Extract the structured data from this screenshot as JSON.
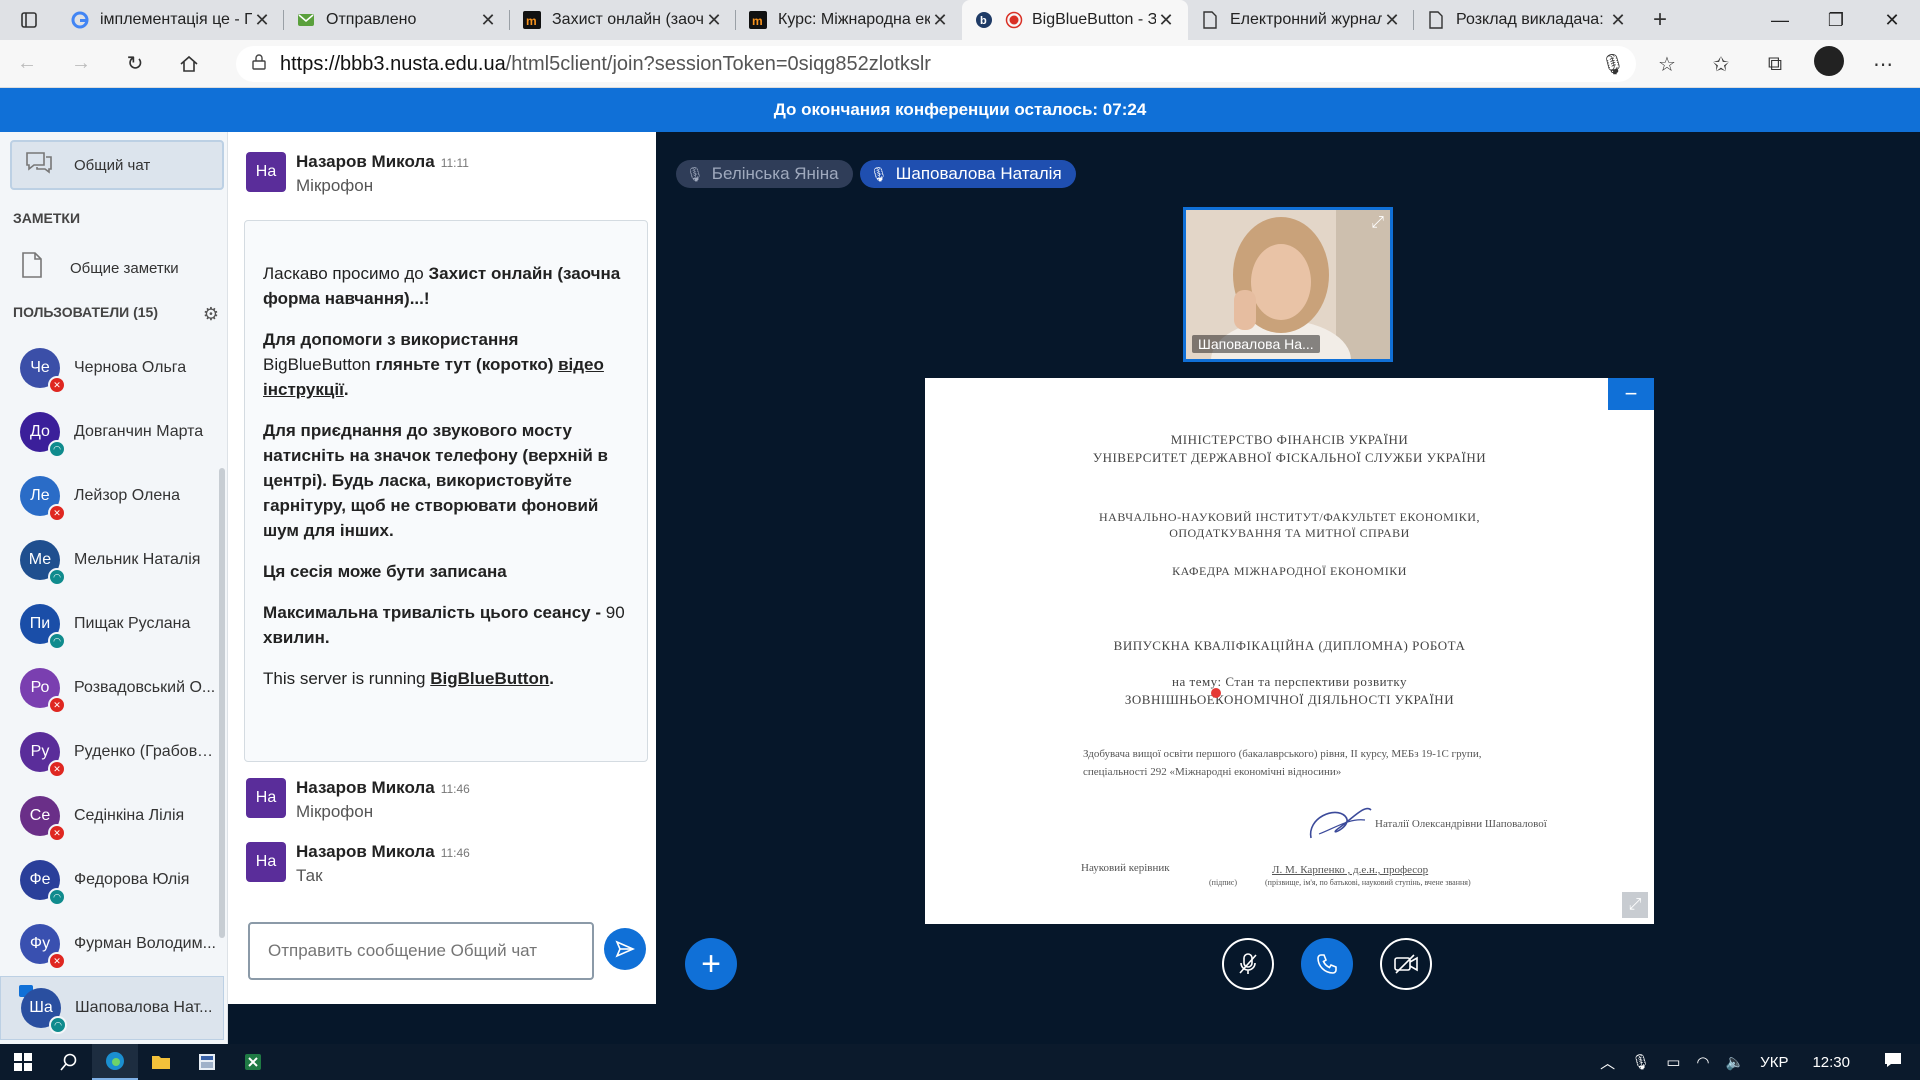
{
  "browser": {
    "tabs": [
      {
        "title": "імплементація це - Пошук",
        "icon": "google-icon"
      },
      {
        "title": "Отправлено",
        "icon": "mail-icon"
      },
      {
        "title": "Захист онлайн (заочна форма)",
        "icon": "moodle-icon"
      },
      {
        "title": "Курс: Міжнародна економіка",
        "icon": "moodle-icon"
      },
      {
        "title": "BigBlueButton - Захист",
        "icon": "bbb-icon",
        "active": true
      },
      {
        "title": "Електронний журнал",
        "icon": "page-icon"
      },
      {
        "title": "Розклад викладача: Карпенко",
        "icon": "page-icon"
      }
    ],
    "url_host": "https://bbb3.nusta.edu.ua",
    "url_path": "/html5client/join?sessionToken=0siqg852zlotkslr"
  },
  "banner": {
    "text": "До окончания конференции осталось: 07:24"
  },
  "sidebar": {
    "public_chat": "Общий чат",
    "notes_title": "ЗАМЕТКИ",
    "shared_notes": "Общие заметки",
    "users_title": "ПОЛЬЗОВАТЕЛИ (15)",
    "users": [
      {
        "initials": "Че",
        "name": "Чернова Ольга",
        "color": "#3b4fa8",
        "status": "muted"
      },
      {
        "initials": "До",
        "name": "Довганчин Марта",
        "color": "#3b1f9a",
        "status": "listen"
      },
      {
        "initials": "Ле",
        "name": "Лейзор Олена",
        "color": "#2a6cc7",
        "status": "muted"
      },
      {
        "initials": "Ме",
        "name": "Мельник Наталія",
        "color": "#1f4f8f",
        "status": "listen"
      },
      {
        "initials": "Пи",
        "name": "Пищак Руслана",
        "color": "#1a4ea8",
        "status": "listen"
      },
      {
        "initials": "Ро",
        "name": "Розвадовський О...",
        "color": "#7a3fb0",
        "status": "muted"
      },
      {
        "initials": "Ру",
        "name": "Руденко (Грабова...",
        "color": "#5a2d9a",
        "status": "muted"
      },
      {
        "initials": "Се",
        "name": "Седінкіна Лілія",
        "color": "#6a2f88",
        "status": "muted"
      },
      {
        "initials": "Фе",
        "name": "Федорова Юлія",
        "color": "#2a3f9a",
        "status": "listen"
      },
      {
        "initials": "Фу",
        "name": "Фурман Володим...",
        "color": "#3950b0",
        "status": "muted"
      },
      {
        "initials": "Ша",
        "name": "Шаповалова Нат...",
        "color": "#2a4fa0",
        "status": "listen",
        "me": true
      }
    ]
  },
  "chat": {
    "messages": [
      {
        "initials": "На",
        "author": "Назаров Микола",
        "time": "11:11",
        "text": "Мікрофон"
      },
      {
        "initials": "На",
        "author": "Назаров Микола",
        "time": "11:46",
        "text": "Мікрофон"
      },
      {
        "initials": "На",
        "author": "Назаров Микола",
        "time": "11:46",
        "text": "Так"
      }
    ],
    "welcome": {
      "p1a": "Ласкаво просимо до ",
      "p1b": "Захист онлайн (заочна форма навчання)...",
      "p1c": "!",
      "p2a": "Для допомоги з використання ",
      "p2b": "BigBlueButton",
      "p2c": " гляньте тут (коротко) ",
      "p2link": "відео інструкції",
      "p2d": ".",
      "p3a": "Для приєднання до звукового мосту натисніть на значок телефону (верхній в центрі). ",
      "p3b": "Будь ласка, використовуйте гарнітуру, щоб не створювати фоновий шум для інших.",
      "p4": "Ця сесія може бути записана",
      "p5a": "Максимальна тривалість цього сеансу - ",
      "p5b": "90",
      "p5c": " хвилин.",
      "p6a": "This server is running ",
      "p6link": "BigBlueButton",
      "p6b": "."
    },
    "input_placeholder": "Отправить сообщение Общий чат"
  },
  "talkers": [
    {
      "name": "Белінська Яніна",
      "active": false
    },
    {
      "name": "Шаповалова Наталія",
      "active": true
    }
  ],
  "webcam": {
    "label": "Шаповалова На..."
  },
  "slide": {
    "l1": "Міністерство фінансів України",
    "l2": "Університет державної фіскальної служби України",
    "l3": "Навчально-науковий інститут/факультет економіки,",
    "l4": "оподаткування та митної справи",
    "l5": "Кафедра міжнародної економіки",
    "l6": "Випускна кваліфікаційна (дипломна) робота",
    "l7": "на тему: Стан та перспективи розвитку",
    "l8": "зовнішньоекономічної діяльності України",
    "l9": "Здобувача вищої освіти першого (бакалаврського) рівня, II курсу, МЕБз 19-1С групи,",
    "l10": "спеціальності 292 «Міжнародні економічні відносини»",
    "l11": "Наталії Олександрівни Шаповалової",
    "l12": "Науковий керівник",
    "l13": "Л. М. Карпенко , д.е.н., професор",
    "l14": "(підпис)",
    "l15": "(прізвище, ім'я, по батькові, науковий ступінь, вчене звання)"
  },
  "taskbar": {
    "lang": "УКР",
    "time": "12:30"
  }
}
